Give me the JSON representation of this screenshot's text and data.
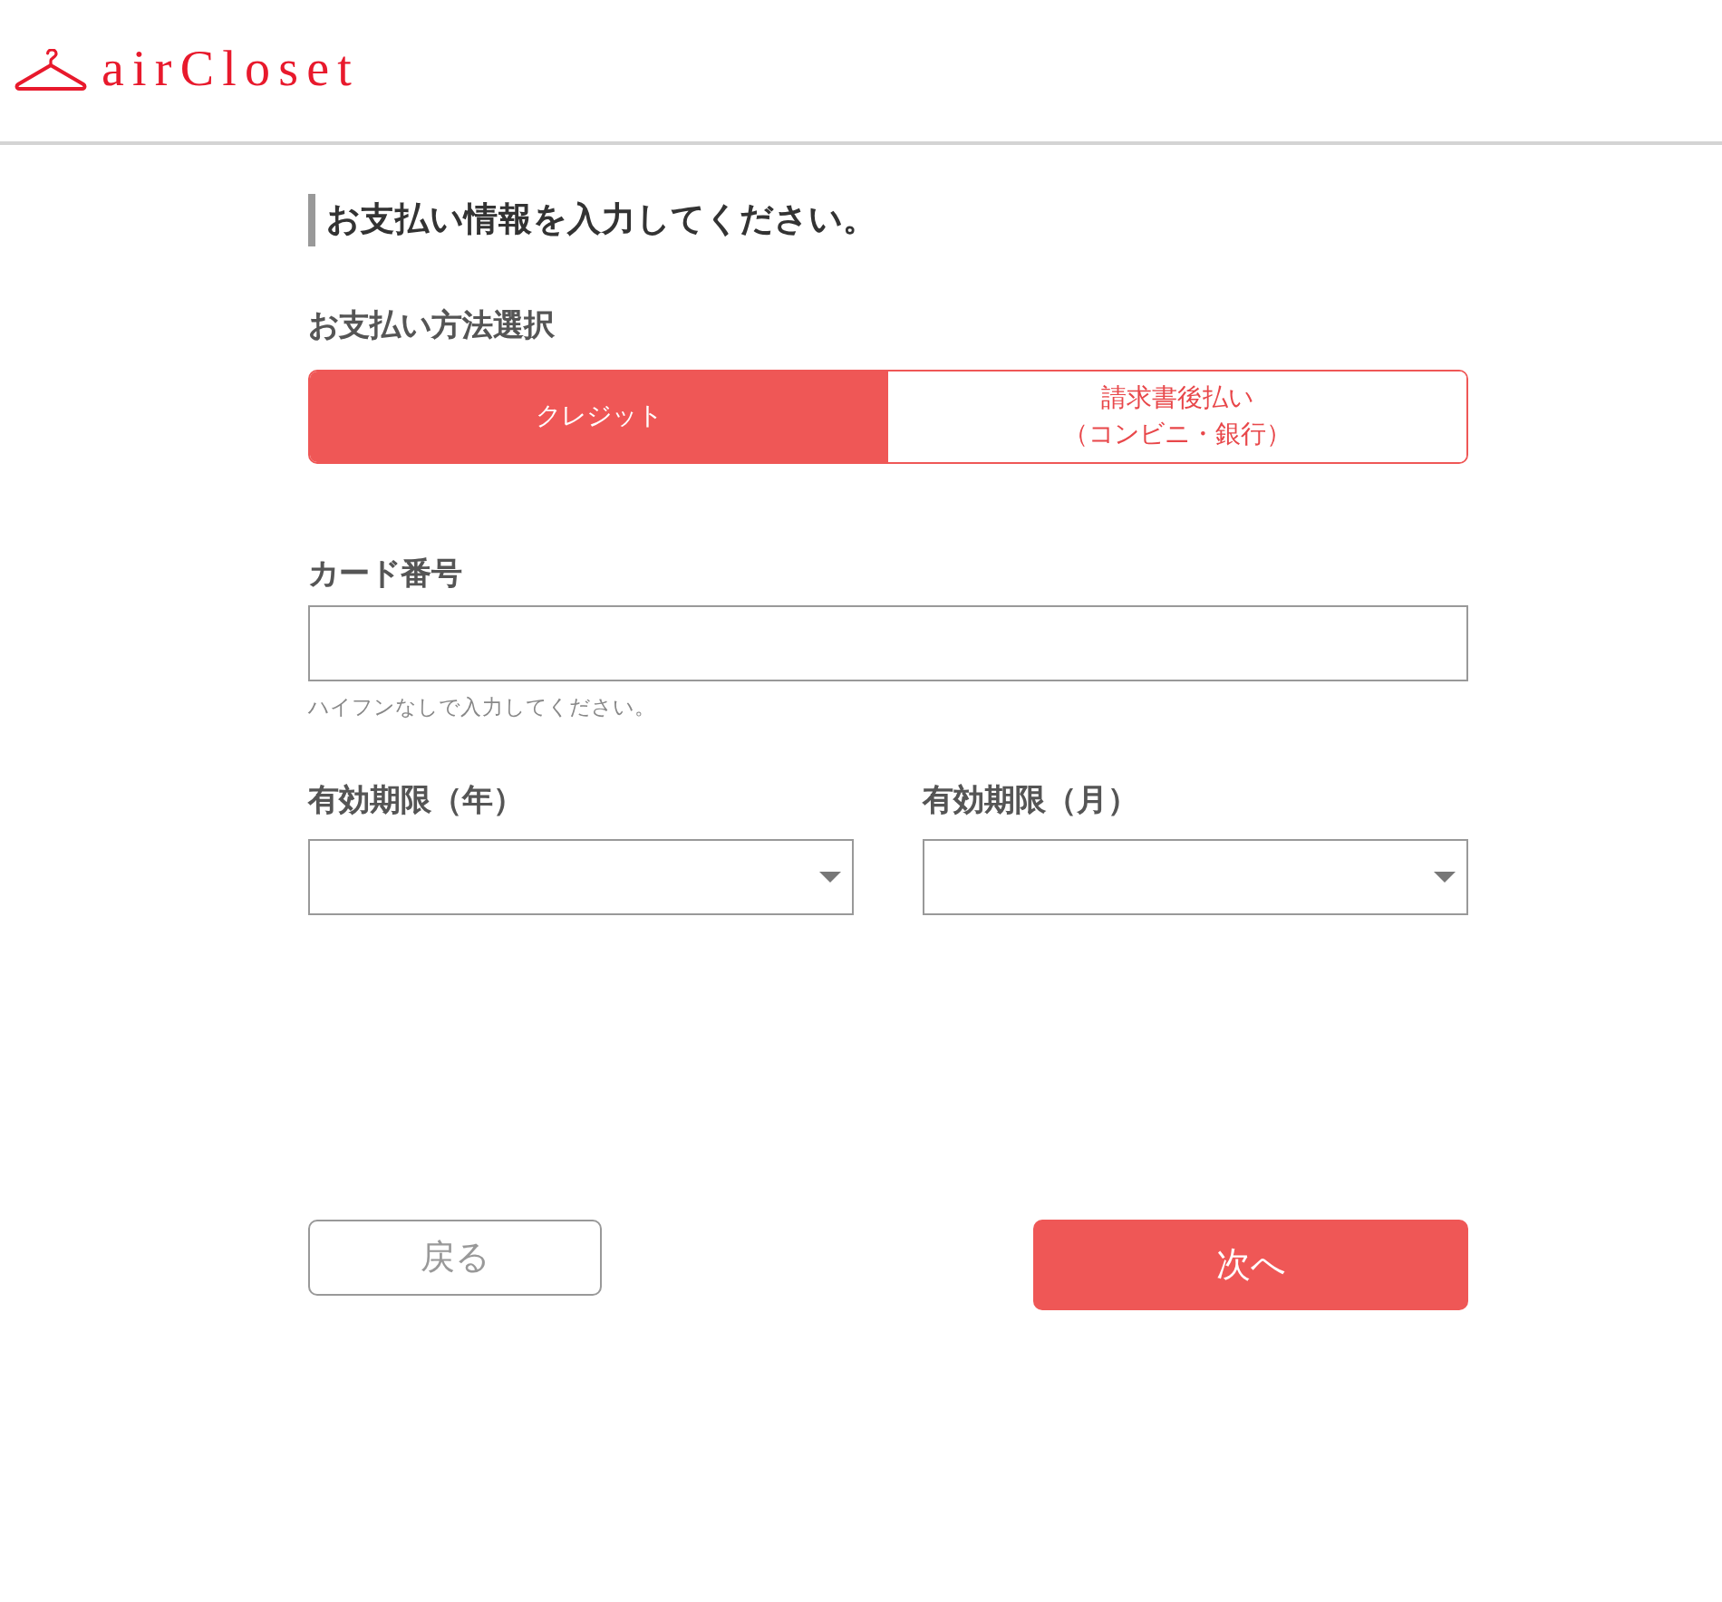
{
  "header": {
    "logo_text": "airCloset"
  },
  "page": {
    "title": "お支払い情報を入力してください。"
  },
  "payment_method": {
    "label": "お支払い方法選択",
    "options": [
      {
        "lines": [
          "クレジット"
        ],
        "selected": true
      },
      {
        "lines": [
          "請求書後払い",
          "（コンビニ・銀行）"
        ],
        "selected": false
      }
    ]
  },
  "card_number": {
    "label": "カード番号",
    "hint": "ハイフンなしで入力してください。"
  },
  "expiry": [
    {
      "label": "有効期限（年）"
    },
    {
      "label": "有効期限（月）"
    }
  ],
  "buttons": [
    {
      "kind": "secondary",
      "label": "戻る"
    },
    {
      "kind": "primary",
      "label": "次へ"
    }
  ]
}
